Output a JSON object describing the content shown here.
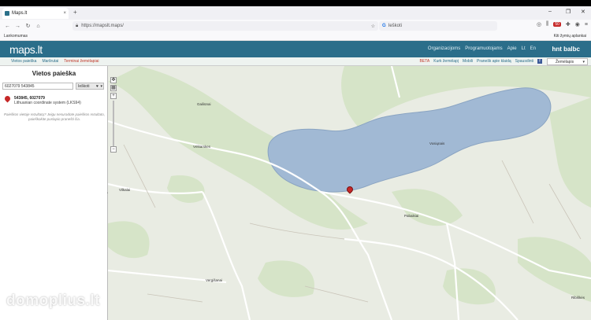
{
  "browser": {
    "tab_title": "Maps.lt",
    "tab_close": "×",
    "new_tab": "+",
    "win_min": "–",
    "win_max": "❐",
    "win_close": "✕",
    "url": "https://mapslt.maps/",
    "search_placeholder": "Ieškoti",
    "bookmark_left": "Lankomumas",
    "bookmark_right": "Kiti žymių aplankai",
    "badge": "50"
  },
  "header": {
    "logo": "maps.lt",
    "links": [
      "Organizacijoms",
      "Programuotojams",
      "Apie",
      "Lt",
      "En"
    ],
    "brand": "hnt balbc"
  },
  "subnav": {
    "left": [
      "Vietos paieška",
      "Maršrutai",
      "Terminai žemėlapiai"
    ],
    "right": [
      "BETA",
      "Kurk žemėlapį",
      "Mobili",
      "Pranešk apie klaidą",
      "Spausdinti"
    ],
    "fb": "f",
    "map_type": "Žemėlapis"
  },
  "sidebar": {
    "title": "Vietos paieška",
    "input_value": "6027079 543845",
    "search_button": "Ieškoti",
    "result_coords": "543845, 6027079",
    "result_system": "Lithuanian coordinate system (LKS94)",
    "hint": "Paieškos vietoje rezultatų? Jeigu nesuradote paieškos rezultato, paieškokite puslapio pranešti čia."
  },
  "map": {
    "labels": [
      "Vėlitarskes",
      "Vosiųnais",
      "Vilkalai",
      "Pabaikiai",
      "Vergišanai",
      "Gailiūnai",
      "Ribiškės"
    ],
    "watermark": "domoplius.lt"
  },
  "icons": {
    "tab_favicon": "maps-favicon",
    "pin": "location-pin-icon"
  }
}
